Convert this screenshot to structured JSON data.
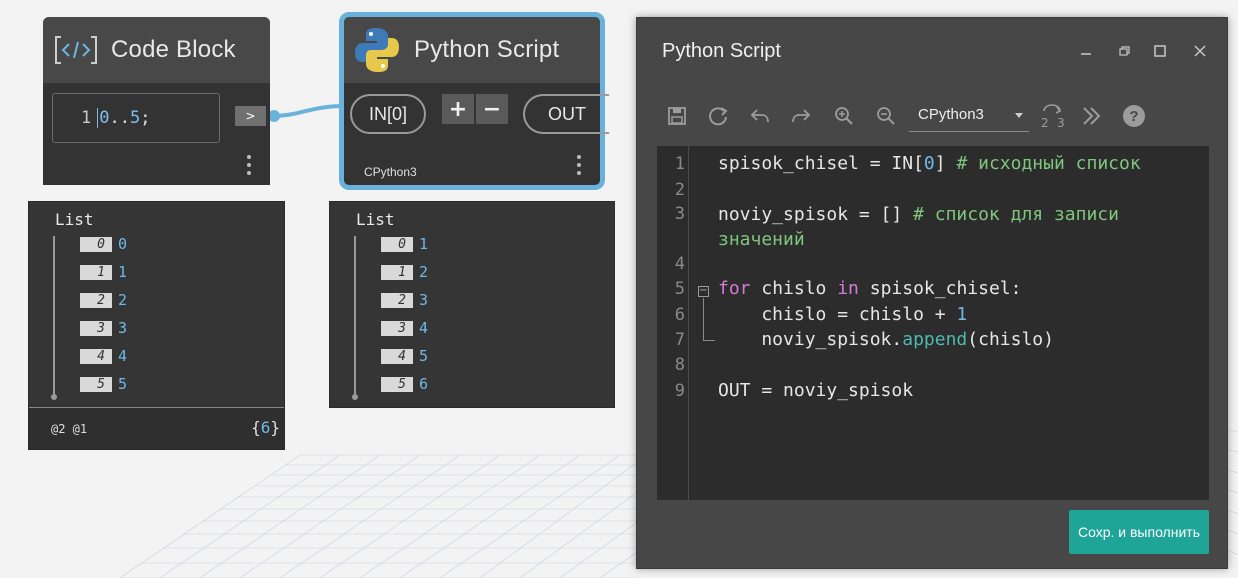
{
  "code_block_node": {
    "title": "Code Block",
    "icon": "code-bracket-icon",
    "line_number": "1",
    "code_num1": "0",
    "code_dots": "..",
    "code_num2": "5",
    "code_semicolon": ";",
    "output_port": ">"
  },
  "python_node": {
    "title": "Python Script",
    "icon": "python-logo-icon",
    "input_port": "IN[0]",
    "add_input": "+",
    "remove_input": "−",
    "output_port": "OUT",
    "engine": "CPython3",
    "accent_color": "#6ab2dc"
  },
  "code_block_preview": {
    "title": "List",
    "items": [
      {
        "index": "0",
        "value": "0"
      },
      {
        "index": "1",
        "value": "1"
      },
      {
        "index": "2",
        "value": "2"
      },
      {
        "index": "3",
        "value": "3"
      },
      {
        "index": "4",
        "value": "4"
      },
      {
        "index": "5",
        "value": "5"
      }
    ],
    "levels": "@2 @1",
    "count_open": "{",
    "count": "6",
    "count_close": "}"
  },
  "python_preview": {
    "title": "List",
    "items": [
      {
        "index": "0",
        "value": "1"
      },
      {
        "index": "1",
        "value": "2"
      },
      {
        "index": "2",
        "value": "3"
      },
      {
        "index": "3",
        "value": "4"
      },
      {
        "index": "4",
        "value": "5"
      },
      {
        "index": "5",
        "value": "6"
      }
    ]
  },
  "editor": {
    "title": "Python Script",
    "engine_select": "CPython3",
    "save_run_label": "Сохр. и выполнить",
    "accent_color": "#1fa598",
    "line_numbers": [
      "1",
      "2",
      "3",
      "4",
      "5",
      "6",
      "7",
      "8",
      "9"
    ],
    "code": {
      "l1_code": "spisok_chisel = IN[",
      "l1_num": "0",
      "l1_rest": "] ",
      "l1_comment": "# исходный список",
      "l3_code": "noviy_spisok = [] ",
      "l3_comment": "# список для записи",
      "l3_comment_wrap": "значений",
      "l5_kw_for": "for",
      "l5_mid": " chislo ",
      "l5_kw_in": "in",
      "l5_rest": " spisok_chisel:",
      "l6_code": "    chislo = chislo + ",
      "l6_num": "1",
      "l7_pre": "    noviy_spisok.",
      "l7_fn": "append",
      "l7_post": "(chislo)",
      "l9_code": "OUT = noviy_spisok"
    }
  }
}
